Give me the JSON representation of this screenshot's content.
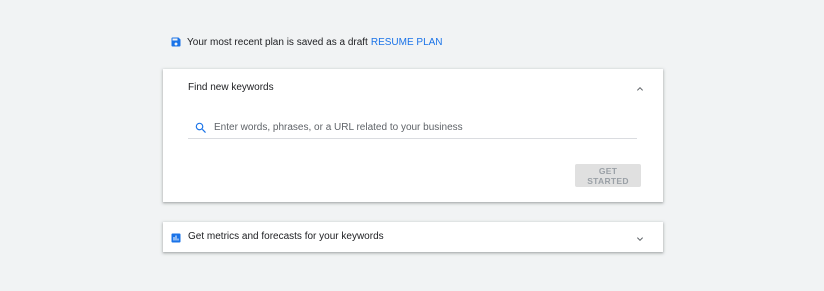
{
  "draft_notice": {
    "icon": "save-icon",
    "text": "Your most recent plan is saved as a draft",
    "link_label": "RESUME PLAN",
    "icon_color": "#1a73e8",
    "link_color": "#1a73e8"
  },
  "find_keywords": {
    "title": "Find new keywords",
    "expanded": true,
    "search_placeholder": "Enter words, phrases, or a URL related to your business",
    "search_value": "",
    "button_label": "GET STARTED",
    "button_enabled": false
  },
  "metrics": {
    "icon": "bar-chart-icon",
    "title": "Get metrics and forecasts for your keywords",
    "expanded": false,
    "icon_color": "#1a73e8"
  },
  "colors": {
    "background": "#f1f3f4",
    "card": "#ffffff",
    "accent": "#1a73e8",
    "text": "#202124",
    "muted": "#5f6368",
    "button_disabled_bg": "#e0e0e0",
    "button_disabled_text": "#9aa0a6"
  }
}
